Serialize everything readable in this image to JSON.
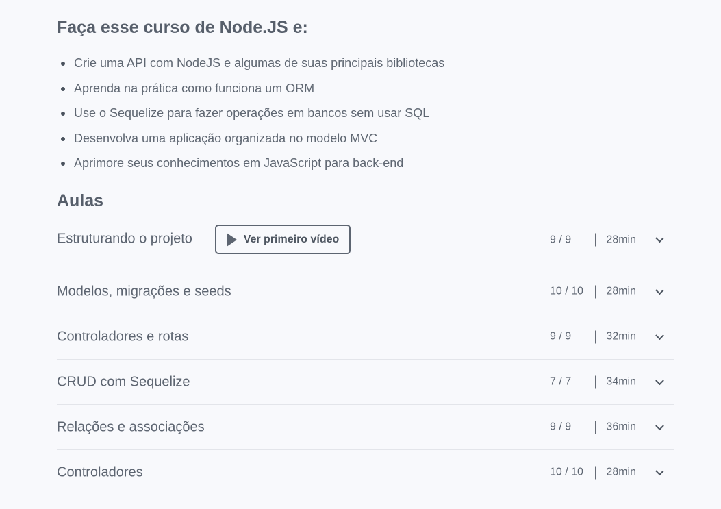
{
  "course": {
    "title": "Faça esse curso de Node.JS e:",
    "benefits": [
      "Crie uma API com NodeJS e algumas de suas principais bibliotecas",
      "Aprenda na prática como funciona um ORM",
      "Use o Sequelize para fazer operações em bancos sem usar SQL",
      "Desenvolva uma aplicação organizada no modelo MVC",
      "Aprimore seus conhecimentos em JavaScript para back-end"
    ]
  },
  "lessons": {
    "title": "Aulas",
    "video_button_label": "Ver primeiro vídeo",
    "separator": "|",
    "items": [
      {
        "title": "Estruturando o projeto",
        "count": "9 / 9",
        "duration": "28min"
      },
      {
        "title": "Modelos, migrações e seeds",
        "count": "10 / 10",
        "duration": "28min"
      },
      {
        "title": "Controladores e rotas",
        "count": "9 / 9",
        "duration": "32min"
      },
      {
        "title": "CRUD com Sequelize",
        "count": "7 / 7",
        "duration": "34min"
      },
      {
        "title": "Relações e associações",
        "count": "9 / 9",
        "duration": "36min"
      },
      {
        "title": "Controladores",
        "count": "10 / 10",
        "duration": "28min"
      }
    ]
  },
  "icons": {
    "play": "play-icon",
    "chevron": "chevron-down-icon"
  },
  "colors": {
    "background": "#f8f9fc",
    "text": "#5d6571",
    "divider": "#e3e5ea"
  }
}
